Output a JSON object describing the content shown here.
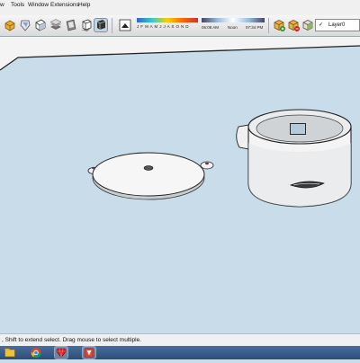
{
  "menubar": {
    "items": [
      "w",
      "Tools",
      "Window",
      "Extensions",
      "Help"
    ]
  },
  "toolbar": {
    "buttons": [
      "components-icon",
      "materials-icon",
      "styles-icon",
      "layers-icon",
      "scenes-icon",
      "shadows-icon",
      "fog-icon"
    ],
    "shadow_settings": {
      "months": "J F M A M J J A S O N D",
      "time_start": "06:08 AM",
      "time_mid": "Noon",
      "time_end": "07:34 PM"
    },
    "layer_tools": [
      "add-layer-icon",
      "delete-layer-icon",
      "layer-color-icon"
    ],
    "layer_select": {
      "checkmark": "✓",
      "value": "Layer0"
    }
  },
  "viewport": {
    "objects": [
      "flat-lid-part",
      "cylindrical-housing-part"
    ]
  },
  "status": {
    "text": ", Shift to extend select. Drag mouse to select multiple."
  },
  "taskbar": {
    "items": [
      "file-explorer-icon",
      "chrome-icon",
      "ruby-icon",
      "sketchup-icon"
    ]
  }
}
